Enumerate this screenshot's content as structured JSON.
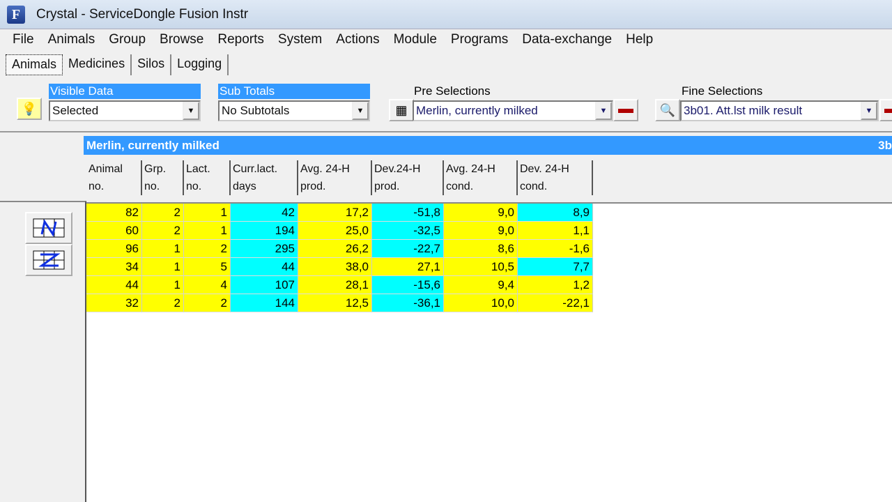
{
  "window": {
    "title": "Crystal - ServiceDongle Fusion Instr",
    "icon_letter": "F"
  },
  "menu": [
    "File",
    "Animals",
    "Group",
    "Browse",
    "Reports",
    "System",
    "Actions",
    "Module",
    "Programs",
    "Data-exchange",
    "Help"
  ],
  "tabs": [
    {
      "label": "Animals",
      "active": true
    },
    {
      "label": "Medicines"
    },
    {
      "label": "Silos"
    },
    {
      "label": "Logging"
    }
  ],
  "toolbar": {
    "visible_data": {
      "label": "Visible Data",
      "value": "Selected"
    },
    "sub_totals": {
      "label": "Sub Totals",
      "value": "No Subtotals"
    },
    "pre_selections": {
      "label": "Pre Selections",
      "value": "Merlin, currently milked"
    },
    "fine_selections": {
      "label": "Fine Selections",
      "value": "3b01. Att.lst milk result"
    }
  },
  "selection_bar": {
    "title": "Merlin, currently milked",
    "right_text": "3b"
  },
  "colors": {
    "yellow": "#ffff00",
    "cyan": "#00ffff",
    "selection_blue": "#3399ff"
  },
  "table": {
    "columns": [
      [
        "Animal",
        "no."
      ],
      [
        "Grp.",
        "no."
      ],
      [
        "Lact.",
        "no."
      ],
      [
        "Curr.lact.",
        "days"
      ],
      [
        "Avg. 24-H",
        "prod."
      ],
      [
        "Dev.24-H",
        "prod."
      ],
      [
        "Avg. 24-H",
        "cond."
      ],
      [
        "Dev. 24-H",
        "cond."
      ]
    ],
    "rows": [
      {
        "cells": [
          "82",
          "2",
          "1",
          "42",
          "17,2",
          "-51,8",
          "9,0",
          "8,9"
        ],
        "colors": "YYYCYCYC"
      },
      {
        "cells": [
          "60",
          "2",
          "1",
          "194",
          "25,0",
          "-32,5",
          "9,0",
          "1,1"
        ],
        "colors": "YYYCYCYY"
      },
      {
        "cells": [
          "96",
          "1",
          "2",
          "295",
          "26,2",
          "-22,7",
          "8,6",
          "-1,6"
        ],
        "colors": "YYYCYCYY"
      },
      {
        "cells": [
          "34",
          "1",
          "5",
          "44",
          "38,0",
          "27,1",
          "10,5",
          "7,7"
        ],
        "colors": "YYYCYYYC"
      },
      {
        "cells": [
          "44",
          "1",
          "4",
          "107",
          "28,1",
          "-15,6",
          "9,4",
          "1,2"
        ],
        "colors": "YYYCYCYY"
      },
      {
        "cells": [
          "32",
          "2",
          "2",
          "144",
          "12,5",
          "-36,1",
          "10,0",
          "-22,1"
        ],
        "colors": "YYYCYCYY"
      }
    ]
  }
}
